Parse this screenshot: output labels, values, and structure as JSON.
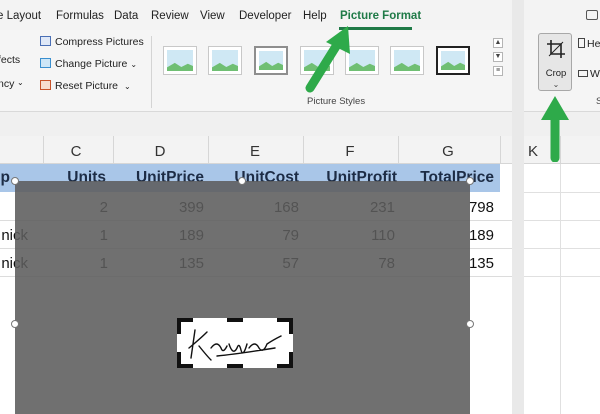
{
  "tabs": [
    "e Layout",
    "Formulas",
    "Data",
    "Review",
    "View",
    "Developer",
    "Help",
    "Picture Format"
  ],
  "active_tab": "Picture Format",
  "ribbon": {
    "adjust_left": [
      "fects",
      "ncy"
    ],
    "compress": "Compress Pictures",
    "change": "Change Picture",
    "reset": "Reset Picture",
    "styles_label": "Picture Styles"
  },
  "columns": [
    "C",
    "D",
    "E",
    "F",
    "G"
  ],
  "right_column": "K",
  "headers": [
    "p",
    "Units",
    "UnitPrice",
    "UnitCost",
    "UnitProfit",
    "TotalPrice"
  ],
  "rows": [
    {
      "b": "",
      "units": "2",
      "price": "399",
      "cost": "168",
      "profit": "231",
      "total": "798"
    },
    {
      "b": "nick",
      "units": "1",
      "price": "189",
      "cost": "79",
      "profit": "110",
      "total": "189"
    },
    {
      "b": "nick",
      "units": "1",
      "price": "135",
      "cost": "57",
      "profit": "78",
      "total": "135"
    }
  ],
  "right_ribbon": {
    "crop_label": "Crop",
    "h_label": "He",
    "w_label": "W"
  },
  "colors": {
    "accent_green": "#1f7a47",
    "annotation_arrow": "#2eaa4a",
    "header_fill": "#a9c6e8"
  }
}
